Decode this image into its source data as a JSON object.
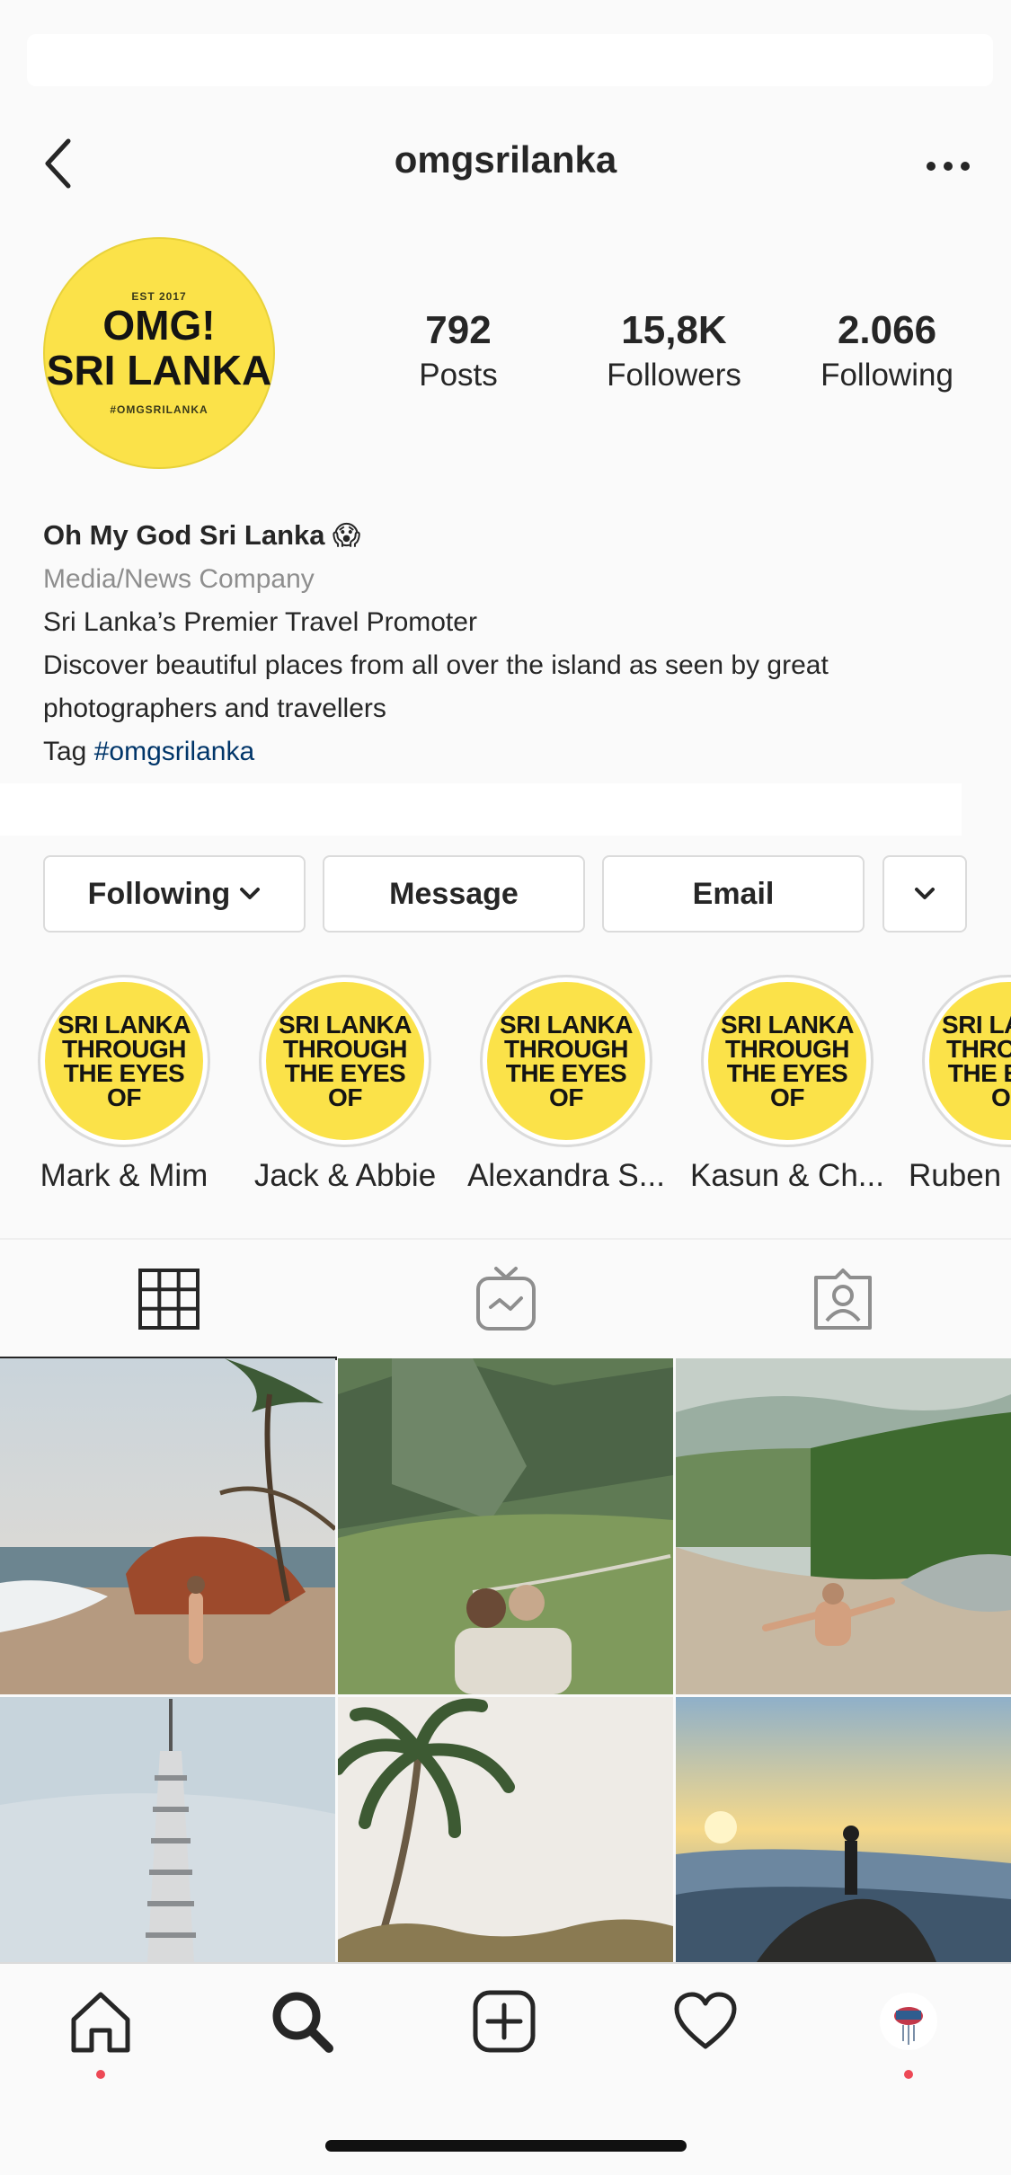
{
  "header": {
    "username": "omgsrilanka"
  },
  "avatar": {
    "est": "EST 2017",
    "line1": "OMG!",
    "line2": "SRI LANKA",
    "tag": "#OMGSRILANKA"
  },
  "stats": {
    "posts_value": "792",
    "posts_label": "Posts",
    "followers_value": "15,8K",
    "followers_label": "Followers",
    "following_value": "2.066",
    "following_label": "Following"
  },
  "bio": {
    "name": "Oh My God Sri Lanka",
    "name_emoji": "😱",
    "category": "Media/News Company",
    "line1": "Sri Lanka’s Premier Travel Promoter",
    "line2": "Discover beautiful places from all over the island as seen by great",
    "line3": "photographers and travellers",
    "tag_prefix": "Tag",
    "hashtag": "#omgsrilanka"
  },
  "actions": {
    "following_label": "Following",
    "message_label": "Message",
    "email_label": "Email"
  },
  "highlights": {
    "cover_text": "SRI LANKA THROUGH THE EYES OF",
    "items": [
      {
        "label": "Mark & Mim"
      },
      {
        "label": "Jack & Abbie"
      },
      {
        "label": "Alexandra S..."
      },
      {
        "label": "Kasun & Ch..."
      },
      {
        "label": "Ruben"
      }
    ]
  },
  "tabs": [
    "grid-posts",
    "igtv",
    "tagged"
  ],
  "colors": {
    "brand_yellow": "#fbe249",
    "link_blue": "#003569",
    "notification_red": "#ed4956",
    "text_primary": "#262626",
    "text_secondary": "#8e8e8e"
  },
  "icons": {
    "back": "chevron-left-icon",
    "more": "more-horizontal-icon",
    "home": "home-icon",
    "search": "search-icon",
    "add": "add-post-icon",
    "activity": "heart-icon",
    "profile": "profile-avatar-icon"
  }
}
